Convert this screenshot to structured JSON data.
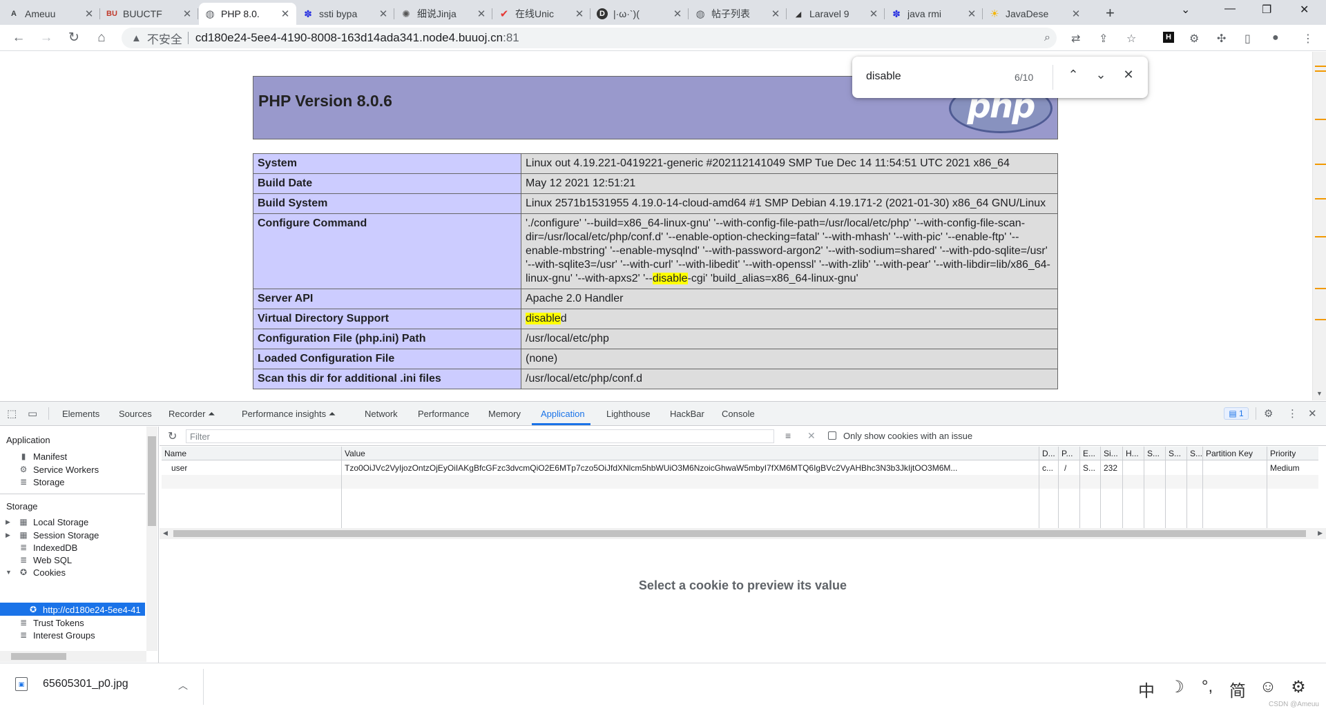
{
  "tabs": [
    {
      "title": "Ameuu",
      "icon": "ameuu-icon",
      "glyph": "A"
    },
    {
      "title": "BUUCTF",
      "icon": "buuctf-icon",
      "glyph": "BU"
    },
    {
      "title": "PHP 8.0.",
      "icon": "globe-icon",
      "glyph": "◍"
    },
    {
      "title": "ssti bypa",
      "icon": "baidu-paw-icon",
      "glyph": "✽"
    },
    {
      "title": "细说Jinja",
      "icon": "spider-icon",
      "glyph": "✺"
    },
    {
      "title": "在线Unic",
      "icon": "checkmark-icon",
      "glyph": "✔"
    },
    {
      "title": "|·ω·`)(",
      "icon": "d-logo-icon",
      "glyph": "D"
    },
    {
      "title": "帖子列表",
      "icon": "globe-icon",
      "glyph": "◍"
    },
    {
      "title": "Laravel 9",
      "icon": "laravel-icon",
      "glyph": "◢"
    },
    {
      "title": "java rmi",
      "icon": "baidu-paw-icon",
      "glyph": "✽"
    },
    {
      "title": "JavaDese",
      "icon": "sun-icon",
      "glyph": "☀"
    }
  ],
  "active_tab_index": 2,
  "address": {
    "security_label": "不安全",
    "host": "cd180e24-5ee4-4190-8008-163d14ada341.node4.buuoj.cn",
    "port": ":81"
  },
  "find": {
    "query": "disable",
    "count": "6/10"
  },
  "php": {
    "header_title": "PHP Version 8.0.6",
    "logo_text": "php",
    "rows": [
      {
        "key": "System",
        "value": "Linux out 4.19.221-0419221-generic #202112141049 SMP Tue Dec 14 11:54:51 UTC 2021 x86_64"
      },
      {
        "key": "Build Date",
        "value": "May 12 2021 12:51:21"
      },
      {
        "key": "Build System",
        "value": "Linux 2571b1531955 4.19.0-14-cloud-amd64 #1 SMP Debian 4.19.171-2 (2021-01-30) x86_64 GNU/Linux"
      },
      {
        "key": "Configure Command",
        "value_pre": "'./configure' '--build=x86_64-linux-gnu' '--with-config-file-path=/usr/local/etc/php' '--with-config-file-scan-dir=/usr/local/etc/php/conf.d' '--enable-option-checking=fatal' '--with-mhash' '--with-pic' '--enable-ftp' '--enable-mbstring' '--enable-mysqlnd' '--with-password-argon2' '--with-sodium=shared' '--with-pdo-sqlite=/usr' '--with-sqlite3=/usr' '--with-curl' '--with-libedit' '--with-openssl' '--with-zlib' '--with-pear' '--with-libdir=lib/x86_64-linux-gnu' '--with-apxs2' '--",
        "value_hl": "disable",
        "value_post": "-cgi' 'build_alias=x86_64-linux-gnu'"
      },
      {
        "key": "Server API",
        "value": "Apache 2.0 Handler"
      },
      {
        "key": "Virtual Directory Support",
        "value_pre": "",
        "value_hl": "disable",
        "value_post": "d"
      },
      {
        "key": "Configuration File (php.ini) Path",
        "value": "/usr/local/etc/php"
      },
      {
        "key": "Loaded Configuration File",
        "value": "(none)"
      },
      {
        "key": "Scan this dir for additional .ini files",
        "value": "/usr/local/etc/php/conf.d"
      }
    ]
  },
  "devtools": {
    "tabs": [
      "Elements",
      "Sources",
      "Recorder ⏶",
      "Performance insights ⏶",
      "Network",
      "Performance",
      "Memory",
      "Application",
      "Lighthouse",
      "HackBar",
      "Console"
    ],
    "active_tab": "Application",
    "issues_count": "1",
    "sidebar": {
      "application_title": "Application",
      "application_items": [
        "Manifest",
        "Service Workers",
        "Storage"
      ],
      "storage_title": "Storage",
      "storage_items": [
        "Local Storage",
        "Session Storage",
        "IndexedDB",
        "Web SQL",
        "Cookies"
      ],
      "cookie_origin": "http://cd180e24-5ee4-41",
      "more_items": [
        "Trust Tokens",
        "Interest Groups"
      ]
    },
    "filter_placeholder": "Filter",
    "only_issues_label": "Only show cookies with an issue",
    "columns": [
      "Name",
      "Value",
      "D...",
      "P...",
      "E...",
      "Si...",
      "H...",
      "S...",
      "S...",
      "S...",
      "Partition Key",
      "Priority"
    ],
    "cookie": {
      "name": "user",
      "value": "Tzo0OiJVc2VyIjozOntzOjEyOiIAKgBfcGFzc3dvcmQiO2E6MTp7czo5OiJfdXNlcm5hbWUiO3M6NzoicGhwaW5mbyI7fXM6MTQ6IgBVc2VyAHBhc3N3b3JkIjtOO3M6M...",
      "domain": "c...",
      "path": "/",
      "expires": "S...",
      "size": "232",
      "priority": "Medium"
    },
    "preview_text": "Select a cookie to preview its value"
  },
  "download": {
    "filename": "65605301_p0.jpg"
  },
  "ime": [
    "中",
    "☽",
    "°,",
    "简",
    "☺",
    "⚙"
  ],
  "watermark": "CSDN @Ameuu"
}
